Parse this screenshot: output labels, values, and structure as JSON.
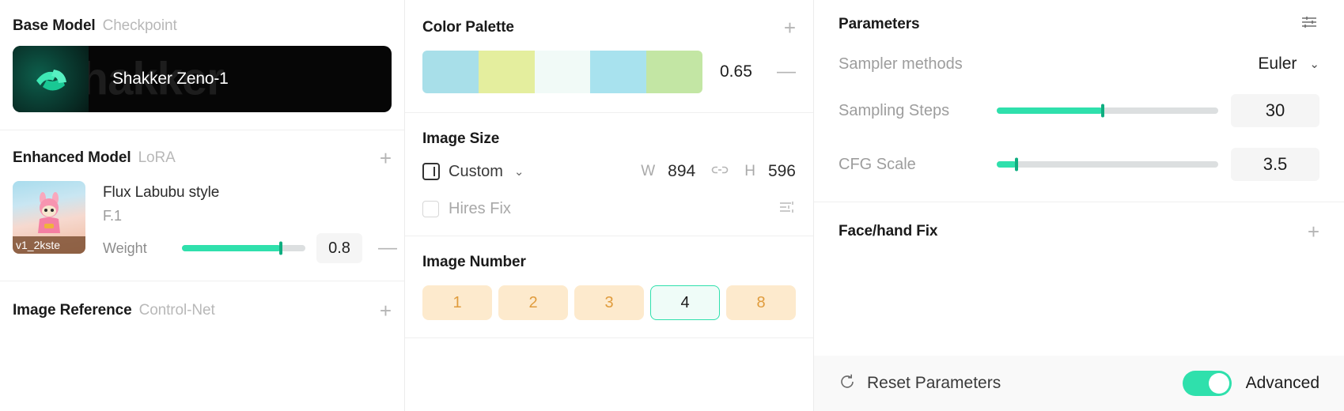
{
  "left_panel": {
    "base_model": {
      "title": "Base Model",
      "subtitle": "Checkpoint",
      "card_name": "Shakker Zeno-1",
      "watermark": "Shakker"
    },
    "enhanced_model": {
      "title": "Enhanced Model",
      "subtitle": "LoRA",
      "add_label": "+",
      "item": {
        "name": "Flux Labubu style",
        "base": "F.1",
        "thumb_badge": "v1_2kste",
        "weight_label": "Weight",
        "weight_value": "0.8",
        "weight_percent": 80,
        "remove_label": "—"
      }
    },
    "image_reference": {
      "title": "Image Reference",
      "subtitle": "Control-Net",
      "add_label": "+"
    }
  },
  "middle_panel": {
    "color_palette": {
      "title": "Color Palette",
      "add_label": "+",
      "swatches": [
        "#a8dfe9",
        "#e4ee9e",
        "#f1faf7",
        "#a8e2ee",
        "#c3e6a4"
      ],
      "value": "0.65",
      "remove_label": "—"
    },
    "image_size": {
      "title": "Image Size",
      "preset": "Custom",
      "chevron": "⌄",
      "width_label": "W",
      "width_value": "894",
      "link_icon": "link-icon",
      "height_label": "H",
      "height_value": "596",
      "hires_fix_label": "Hires Fix",
      "hires_fix_checked": false
    },
    "image_number": {
      "title": "Image Number",
      "options": [
        "1",
        "2",
        "3",
        "4",
        "8"
      ],
      "selected": "4"
    }
  },
  "right_panel": {
    "parameters": {
      "title": "Parameters",
      "settings_icon": "sliders-icon",
      "rows": [
        {
          "label": "Sampler methods",
          "type": "select",
          "value": "Euler",
          "chevron": "⌄"
        },
        {
          "label": "Sampling Steps",
          "type": "slider",
          "value": "30",
          "percent": 48
        },
        {
          "label": "CFG Scale",
          "type": "slider",
          "value": "3.5",
          "percent": 9
        }
      ]
    },
    "face_hand_fix": {
      "title": "Face/hand Fix",
      "add_label": "+"
    },
    "footer": {
      "reset_icon": "refresh-icon",
      "reset_label": "Reset Parameters",
      "advanced_label": "Advanced",
      "advanced_on": true
    }
  },
  "colors": {
    "accent_teal": "#2fe0ac",
    "accent_orange": "#e09c3d",
    "orange_bg": "#fdeacd"
  }
}
